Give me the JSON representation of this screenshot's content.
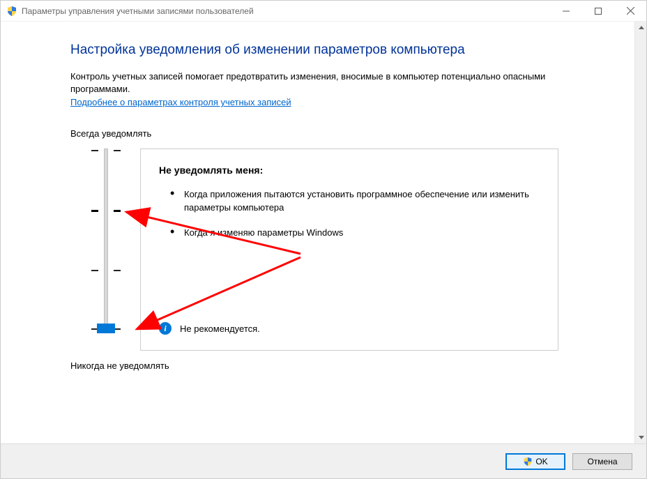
{
  "window": {
    "title": "Параметры управления учетными записями пользователей"
  },
  "page": {
    "heading": "Настройка уведомления об изменении параметров компьютера",
    "description": "Контроль учетных записей помогает предотвратить изменения, вносимые в компьютер потенциально опасными программами.",
    "link_text": "Подробнее о параметрах контроля учетных записей"
  },
  "slider": {
    "top_label": "Всегда уведомлять",
    "bottom_label": "Никогда не уведомлять",
    "level_count": 4,
    "current_level": 0
  },
  "info_box": {
    "title": "Не уведомлять меня:",
    "bullets": [
      "Когда приложения пытаются установить программное обеспечение или изменить параметры компьютера",
      "Когда я изменяю параметры Windows"
    ],
    "recommendation": "Не рекомендуется."
  },
  "footer": {
    "ok_label": "OK",
    "cancel_label": "Отмена"
  }
}
